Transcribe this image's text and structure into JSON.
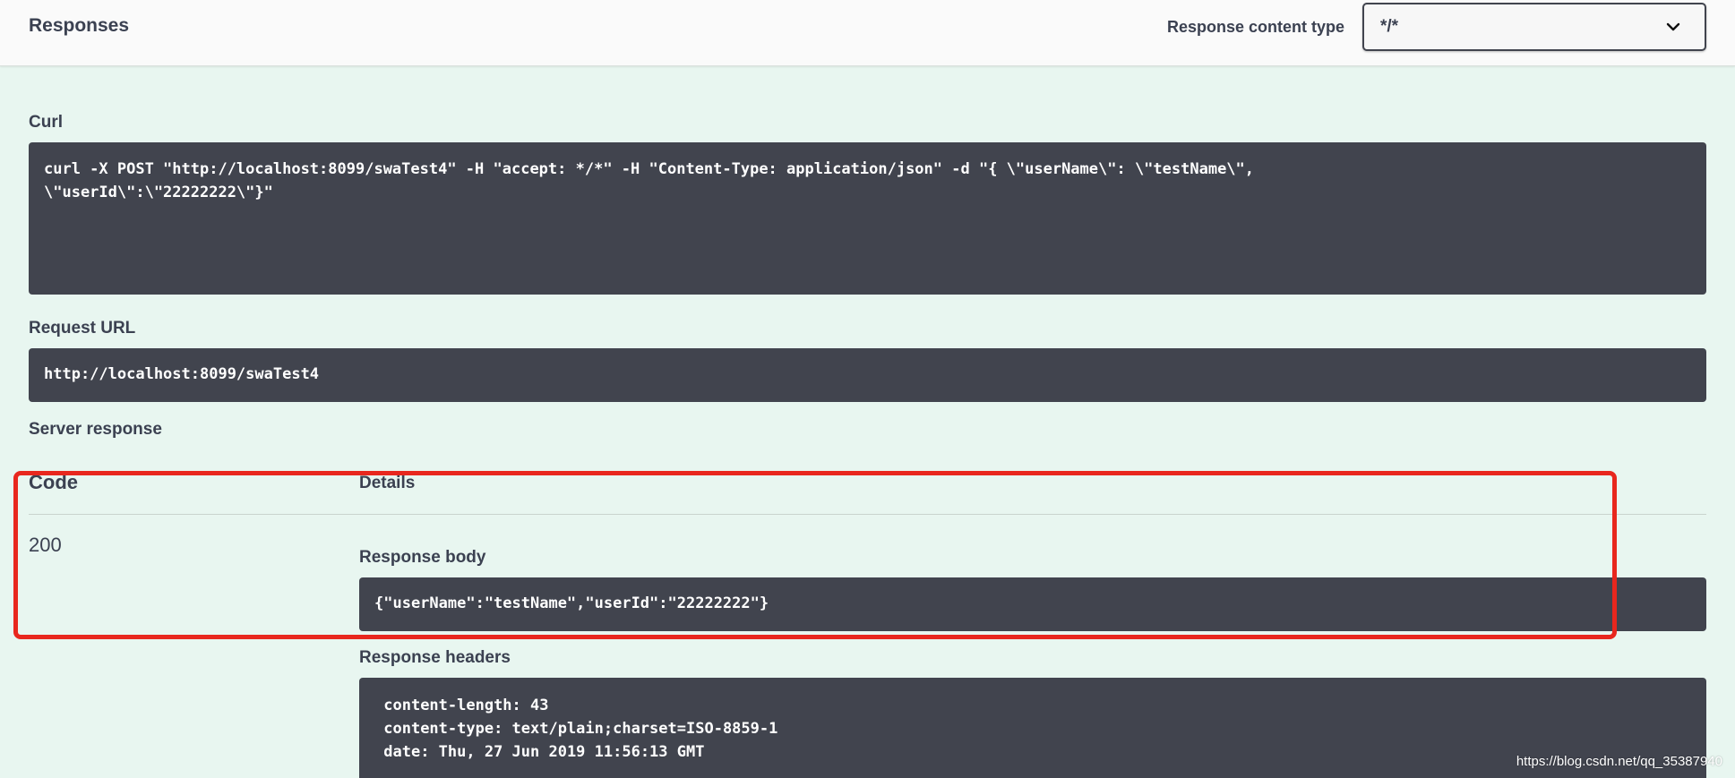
{
  "header": {
    "title": "Responses",
    "content_type_label": "Response content type",
    "content_type_value": "*/*"
  },
  "curl": {
    "label": "Curl",
    "command": "curl -X POST \"http://localhost:8099/swaTest4\" -H \"accept: */*\" -H \"Content-Type: application/json\" -d \"{ \\\"userName\\\": \\\"testName\\\",\n\\\"userId\\\":\\\"22222222\\\"}\""
  },
  "request_url": {
    "label": "Request URL",
    "value": "http://localhost:8099/swaTest4"
  },
  "server_response": {
    "label": "Server response",
    "col_code": "Code",
    "col_details": "Details",
    "code": "200",
    "body_label": "Response body",
    "body": "{\"userName\":\"testName\",\"userId\":\"22222222\"}",
    "headers_label": "Response headers",
    "headers": " content-length: 43\n content-type: text/plain;charset=ISO-8859-1\n date: Thu, 27 Jun 2019 11:56:13 GMT"
  },
  "watermark": "https://blog.csdn.net/qq_35387940",
  "colors": {
    "background": "#e8f6f0",
    "code_block": "#41444e",
    "highlight": "#e8271e",
    "text": "#3b4151"
  },
  "icons": {
    "select_arrow": "chevron-down-icon"
  }
}
